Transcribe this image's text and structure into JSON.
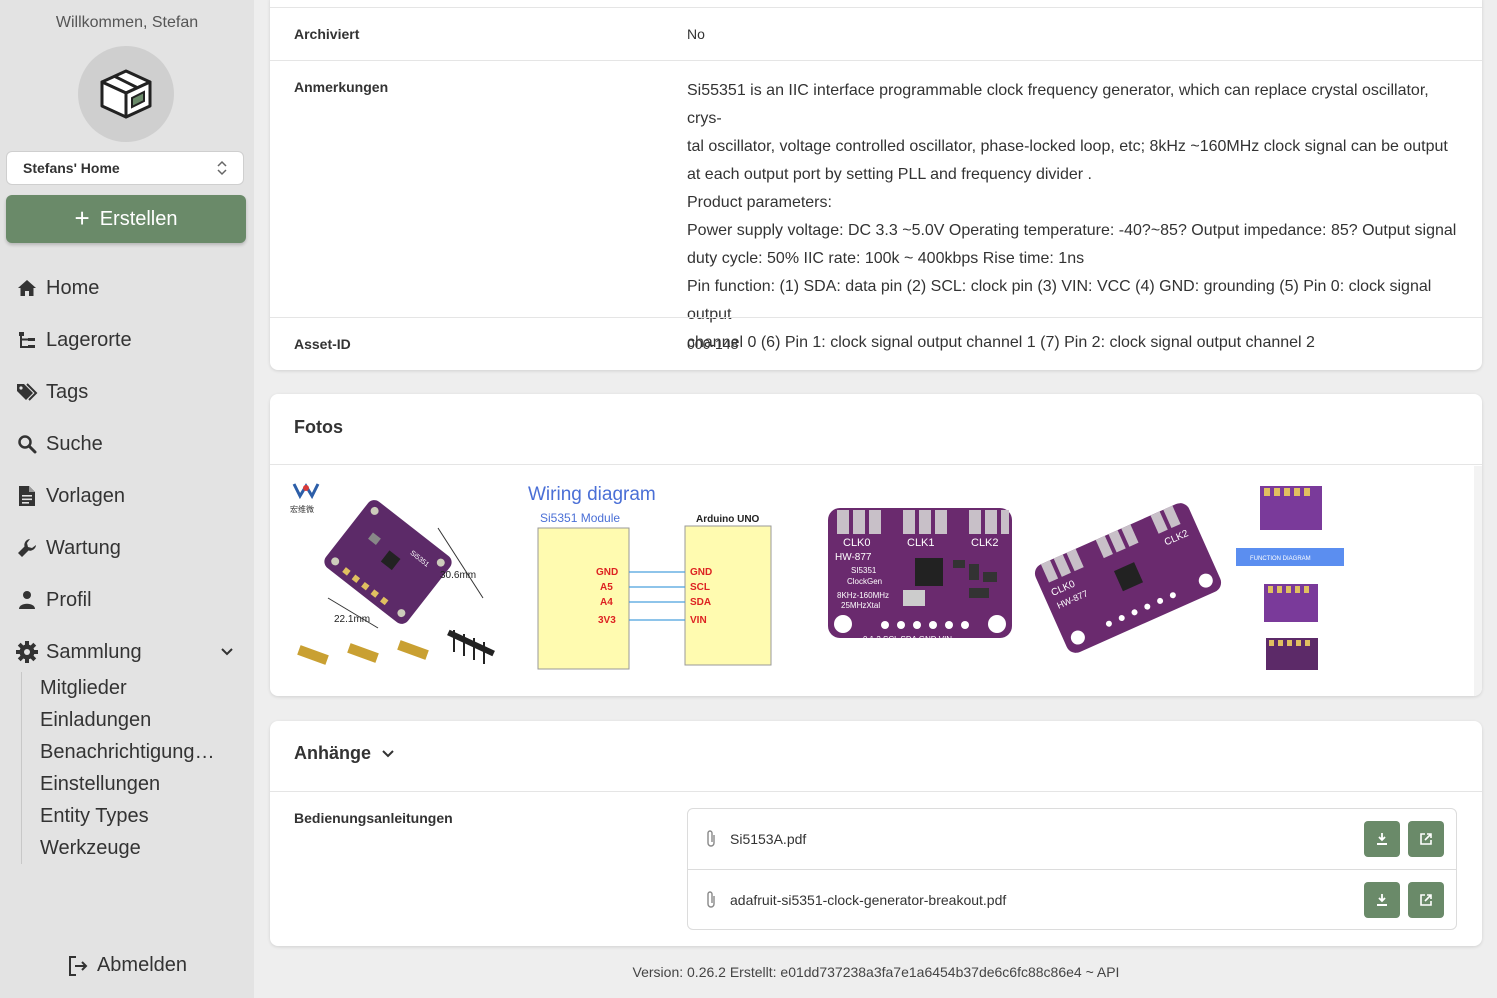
{
  "sidebar": {
    "welcome": "Willkommen, Stefan",
    "home_select": "Stefans' Home",
    "create_label": "Erstellen",
    "nav": [
      {
        "label": "Home",
        "icon": "home-icon"
      },
      {
        "label": "Lagerorte",
        "icon": "tree-icon"
      },
      {
        "label": "Tags",
        "icon": "tags-icon"
      },
      {
        "label": "Suche",
        "icon": "search-icon"
      },
      {
        "label": "Vorlagen",
        "icon": "document-icon"
      },
      {
        "label": "Wartung",
        "icon": "wrench-icon"
      },
      {
        "label": "Profil",
        "icon": "person-icon"
      },
      {
        "label": "Sammlung",
        "icon": "gear-icon"
      }
    ],
    "subnav": [
      "Mitglieder",
      "Einladungen",
      "Benachrichtigungen",
      "Einstellungen",
      "Entity Types",
      "Werkzeuge"
    ],
    "logout": "Abmelden"
  },
  "details": {
    "archived": {
      "label": "Archiviert",
      "value": "No"
    },
    "notes": {
      "label": "Anmerkungen",
      "lines": [
        "Si55351 is an IIC interface programmable clock frequency generator, which can replace crystal oscillator, crys-",
        "tal oscillator, voltage controlled oscillator, phase-locked loop, etc; 8kHz ~160MHz clock signal can be output",
        "at each output port by setting PLL and frequency divider .",
        "Product parameters:",
        "Power supply voltage: DC 3.3 ~5.0V Operating temperature: -40?~85? Output impedance: 85? Output signal",
        "duty cycle: 50% IIC rate: 100k ~ 400kbps Rise time: 1ns",
        "Pin function: (1) SDA: data pin (2) SCL: clock pin (3) VIN: VCC (4) GND: grounding (5) Pin 0: clock signal output",
        "channel 0 (6) Pin 1: clock signal output channel 1 (7) Pin 2: clock signal output channel 2"
      ]
    },
    "asset_id": {
      "label": "Asset-ID",
      "value": "000-148"
    }
  },
  "photos": {
    "title": "Fotos",
    "p1": {
      "logo": "宏维微",
      "dim1": "30.6mm",
      "dim2": "22.1mm",
      "label": "Si5351"
    },
    "p2": {
      "title": "Wiring diagram",
      "module": "Si5351 Module",
      "uno": "Arduino UNO",
      "left_pins": [
        "GND",
        "A5",
        "A4",
        "3V3"
      ],
      "right_pins": [
        "GND",
        "SCL",
        "SDA",
        "VIN"
      ]
    },
    "p3": {
      "clk0": "CLK0",
      "clk1": "CLK1",
      "clk2": "CLK2",
      "model": "HW-877",
      "chip": "SI5351",
      "name": "ClockGen",
      "freq": "8KHz-160MHz",
      "xtal": "25MHzXtal",
      "pins": "0 1 2 SCL SDA GND VIN"
    },
    "p4": {
      "clk0": "CLK0",
      "clk2": "CLK2",
      "model": "HW-877"
    },
    "p5": {
      "band": "FUNCTION DIAGRAM"
    }
  },
  "attachments": {
    "title": "Anhänge",
    "section_label": "Bedienungsanleitungen",
    "files": [
      {
        "name": "Si5153A.pdf"
      },
      {
        "name": "adafruit-si5351-clock-generator-breakout.pdf"
      }
    ]
  },
  "footer": "Version: 0.26.2 Erstellt: e01dd737238a3fa7e1a6454b37de6c6fc88c86e4 ~ API",
  "colors": {
    "accent": "#6a8a69",
    "board_purple": "#5c2a68",
    "sidebar_bg": "#e3e3e3"
  }
}
